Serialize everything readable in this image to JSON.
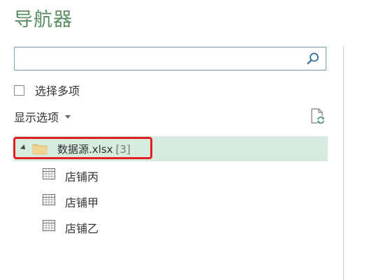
{
  "navigator": {
    "title": "导航器",
    "search": {
      "value": "",
      "placeholder": ""
    },
    "multi_select": {
      "label": "选择多项",
      "checked": false
    },
    "display_options": {
      "label": "显示选项"
    },
    "tree": {
      "root": {
        "label": "数据源.xlsx",
        "count": "[3]",
        "icon": "folder-icon",
        "expanded": true
      },
      "items": [
        {
          "label": "店铺丙",
          "icon": "table-icon"
        },
        {
          "label": "店铺甲",
          "icon": "table-icon"
        },
        {
          "label": "店铺乙",
          "icon": "table-icon"
        }
      ]
    },
    "colors": {
      "title": "#5b8c62",
      "selected_row": "#d6ece0",
      "highlight_box": "#e02020",
      "search_border": "#6fa5b8",
      "folder": "#e8c77f"
    }
  }
}
